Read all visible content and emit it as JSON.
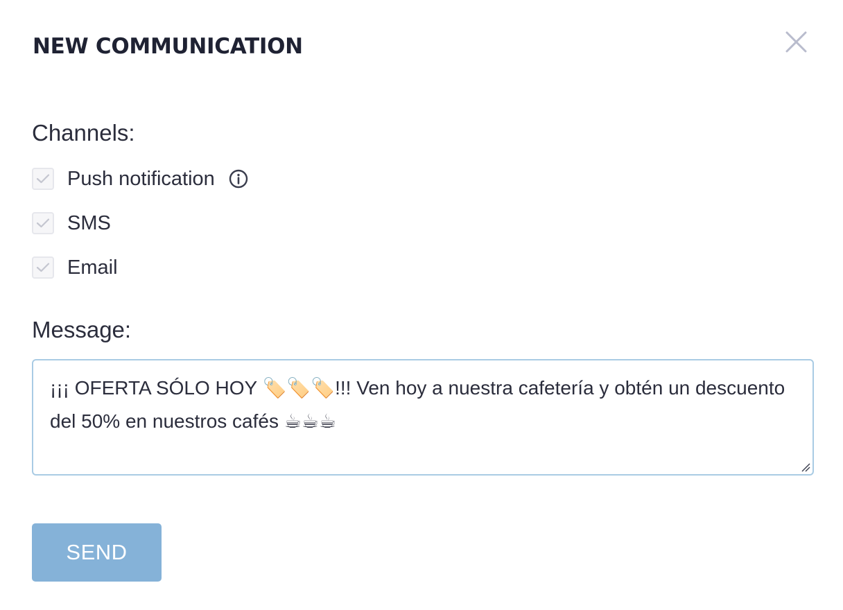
{
  "dialog": {
    "title": "NEW COMMUNICATION",
    "close_icon": "close-icon"
  },
  "channels": {
    "label": "Channels:",
    "items": [
      {
        "label": "Push notification",
        "checked": true,
        "info_icon": "info-icon"
      },
      {
        "label": "SMS",
        "checked": true
      },
      {
        "label": "Email",
        "checked": true
      }
    ]
  },
  "message": {
    "label": "Message:",
    "value": "¡¡¡ OFERTA SÓLO HOY 🏷️🏷️🏷️!!! Ven hoy a nuestra cafetería y obtén un descuento del 50% en nuestros cafés ☕☕☕"
  },
  "send_button": {
    "label": "SEND"
  },
  "colors": {
    "send_button_bg": "#85b2d8",
    "message_border": "#a9cbe4",
    "checkbox_border": "#e6e7ec",
    "text": "#2b2d3c"
  }
}
